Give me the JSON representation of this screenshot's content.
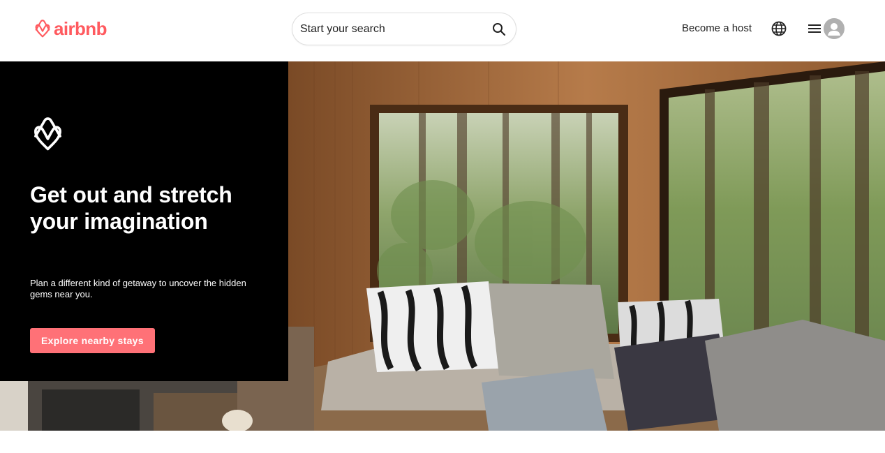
{
  "header": {
    "logo_text": "airbnb",
    "search": {
      "placeholder": "Start your search"
    },
    "become_host": "Become a host"
  },
  "icons": {
    "logo": "airbnb-belo-icon",
    "search": "search-icon",
    "globe": "globe-icon",
    "menu": "hamburger-menu-icon",
    "avatar": "user-avatar-icon"
  },
  "hero": {
    "title_line1": "Get out and stretch",
    "title_line2": "your imagination",
    "subtitle": "Plan a different kind of getaway to uncover the hidden gems near you.",
    "cta_label": "Explore nearby stays"
  },
  "colors": {
    "brand": "#ff5a5f",
    "cta": "#ff7177",
    "panel": "#000000",
    "text": "#222222"
  }
}
